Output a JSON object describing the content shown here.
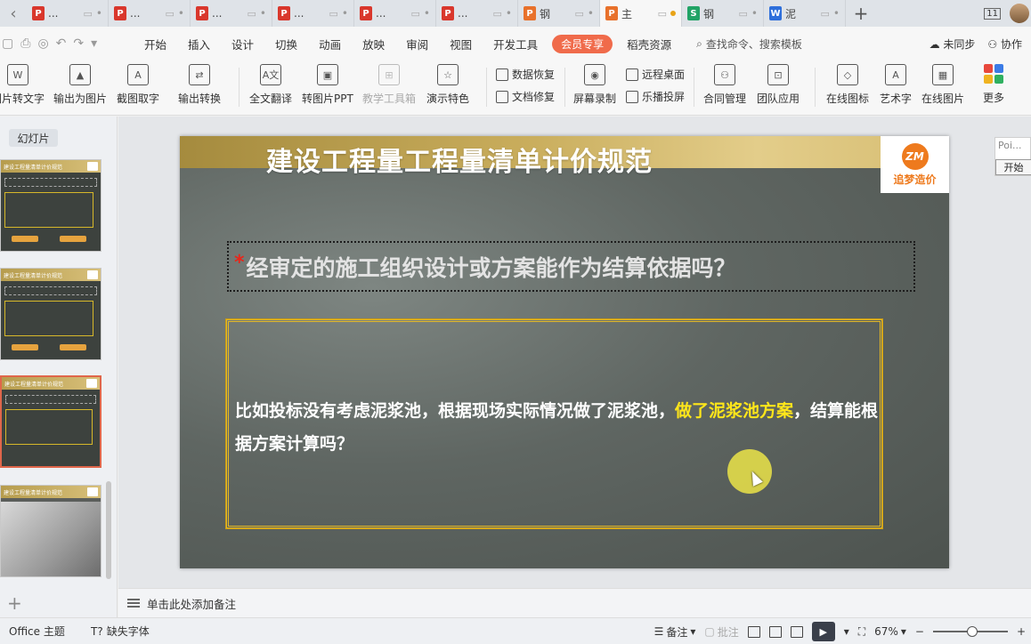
{
  "tabs": [
    {
      "icon": "P",
      "icon_color": "red",
      "label": "..."
    },
    {
      "icon": "P",
      "icon_color": "red",
      "label": "..."
    },
    {
      "icon": "P",
      "icon_color": "red",
      "label": "..."
    },
    {
      "icon": "P",
      "icon_color": "red",
      "label": "..."
    },
    {
      "icon": "P",
      "icon_color": "red",
      "label": "..."
    },
    {
      "icon": "P",
      "icon_color": "red",
      "label": "..."
    },
    {
      "icon": "P",
      "icon_color": "orange",
      "label": "钢"
    },
    {
      "icon": "P",
      "icon_color": "orange",
      "label": "主"
    },
    {
      "icon": "S",
      "icon_color": "green",
      "label": "钢"
    },
    {
      "icon": "W",
      "icon_color": "blue",
      "label": "泥"
    }
  ],
  "window_count": "11",
  "menu": {
    "items": [
      "开始",
      "插入",
      "设计",
      "切换",
      "动画",
      "放映",
      "审阅",
      "视图",
      "开发工具"
    ],
    "vip": "会员专享",
    "resource": "稻壳资源",
    "search": "查找命令、搜索模板",
    "sync": "未同步",
    "collab": "协作"
  },
  "ribbon": {
    "img_to_text": "图片转文字",
    "export_img": "输出为图片",
    "screenshot_text": "截图取字",
    "export_convert": "输出转换",
    "full_translate": "全文翻译",
    "to_img_ppt": "转图片PPT",
    "teach_tools": "教学工具箱",
    "show_features": "演示特色",
    "data_recover": "数据恢复",
    "doc_repair": "文档修复",
    "screen_record": "屏幕录制",
    "remote_desktop": "远程桌面",
    "cast": "乐播投屏",
    "contract_mgmt": "合同管理",
    "team_apps": "团队应用",
    "online_icons": "在线图标",
    "art_text": "艺术字",
    "online_images": "在线图片",
    "more": "更多"
  },
  "left_panel": {
    "label": "幻灯片",
    "thumb_title": "建设工程量清单计价规范"
  },
  "slide": {
    "title": "建设工程量工程量清单计价规范",
    "logo_mark": "ZM",
    "logo_text": "追梦造价",
    "question_star": "*",
    "question": "经审定的施工组织设计或方案能作为结算依据吗？",
    "answer_part1": "比如投标没有考虑泥浆池，根据现场实际情况做了泥浆池，",
    "answer_highlight": "做了泥浆池方案",
    "answer_part2": "，结算能根据方案计算吗？"
  },
  "popup": {
    "title": "Poi...",
    "button": "开始"
  },
  "notes_placeholder": "单击此处添加备注",
  "status": {
    "theme": "Office 主题",
    "missing_font": "缺失字体",
    "notes": "备注",
    "comments": "批注",
    "zoom": "67%"
  },
  "colors": {
    "accent_red": "#e8261a",
    "highlight_yellow": "#ffe61a",
    "answer_border": "#e5b925",
    "vip_orange": "#f06b4b",
    "logo_orange": "#ee7a1d"
  }
}
